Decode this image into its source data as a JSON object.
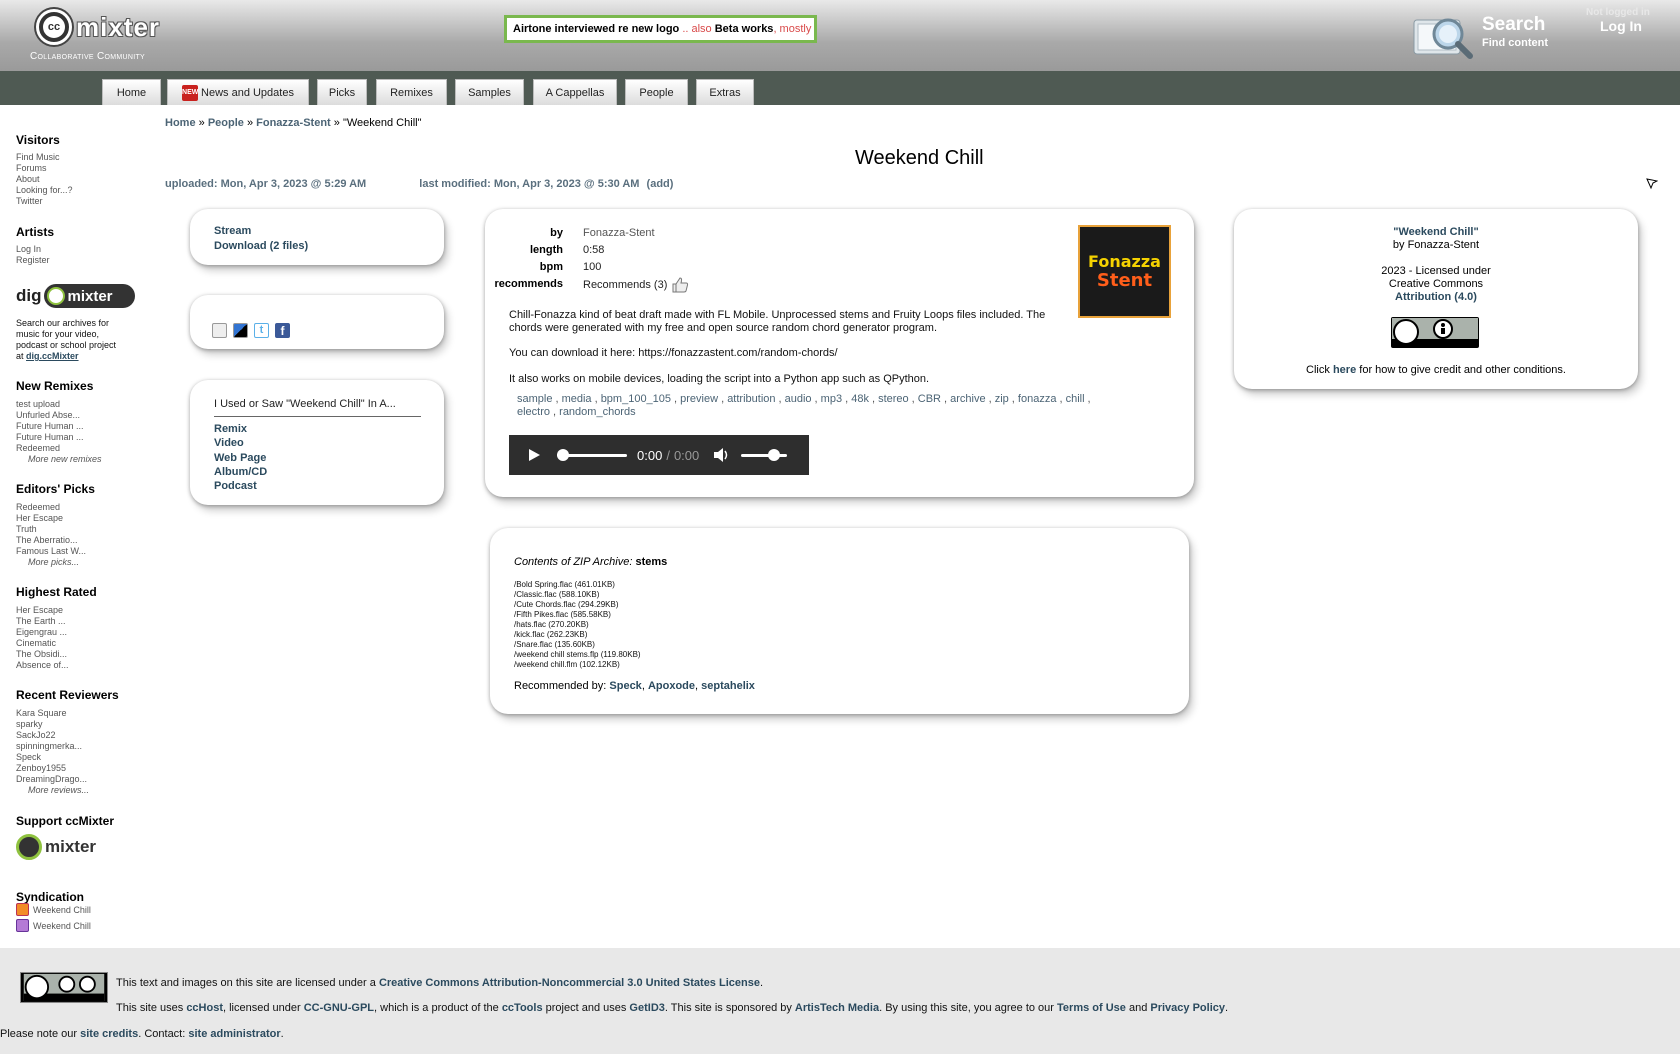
{
  "header": {
    "logo_text": "mixter",
    "tagline": "Collaborative Community",
    "banner": {
      "part1": "Airtone interviewed re new logo",
      "sep": " .. also ",
      "part2": "Beta works",
      "part3": ", mostly"
    },
    "search_title": "Search",
    "search_sub": "Find content",
    "not_logged": "Not logged in",
    "login": "Log In"
  },
  "nav": {
    "tabs": [
      {
        "label": "Home"
      },
      {
        "label": "News and Updates",
        "badge": "NEW"
      },
      {
        "label": "Picks"
      },
      {
        "label": "Remixes"
      },
      {
        "label": "Samples"
      },
      {
        "label": "A Cappellas"
      },
      {
        "label": "People"
      },
      {
        "label": "Extras"
      }
    ]
  },
  "sidebar": {
    "visitors": {
      "title": "Visitors",
      "links": [
        "Find Music",
        "Forums",
        "About",
        "Looking for...?",
        "Twitter"
      ]
    },
    "artists": {
      "title": "Artists",
      "links": [
        "Log In",
        "Register"
      ]
    },
    "dig": {
      "logo": "dig",
      "text": "Search our archives for music for your video, podcast or school project at",
      "link": "dig.ccMixter"
    },
    "new_remixes": {
      "title": "New Remixes",
      "links": [
        "test upload",
        "Unfurled Abse...",
        "Future Human ...",
        "Future Human ...",
        "Redeemed"
      ],
      "more": "More new remixes"
    },
    "editors_picks": {
      "title": "Editors' Picks",
      "links": [
        "Redeemed",
        "Her Escape",
        "Truth",
        "The Aberratio...",
        "Famous Last W..."
      ],
      "more": "More picks..."
    },
    "highest_rated": {
      "title": "Highest Rated",
      "links": [
        "Her Escape",
        "The Earth ...",
        "Eigengrau ...",
        "Cinematic",
        "The Obsidi...",
        "Absence of..."
      ]
    },
    "recent_reviewers": {
      "title": "Recent Reviewers",
      "links": [
        "Kara Square",
        "sparky",
        "SackJo22",
        "spinningmerka...",
        "Speck",
        "Zenboy1955",
        "DreamingDrago..."
      ],
      "more": "More reviews..."
    },
    "support": {
      "title": "Support ccMixter"
    },
    "syndication": {
      "title": "Syndication",
      "links": [
        "Weekend Chill",
        "Weekend Chill"
      ]
    }
  },
  "breadcrumb": {
    "home": "Home",
    "sep": "»",
    "people": "People",
    "artist": "Fonazza-Stent",
    "current": "\"Weekend Chill\""
  },
  "page": {
    "title": "Weekend Chill",
    "uploaded": "uploaded: Mon, Apr 3, 2023 @ 5:29 AM",
    "modified": "last modified: Mon, Apr 3, 2023 @ 5:30 AM",
    "add": "(add)"
  },
  "stream_panel": {
    "stream": "Stream",
    "download": "Download (2 files)"
  },
  "used_panel": {
    "heading": "I Used or Saw \"Weekend Chill\" In A...",
    "items": [
      "Remix",
      "Video",
      "Web Page",
      "Album/CD",
      "Podcast"
    ]
  },
  "details": {
    "by_label": "by",
    "by": "Fonazza-Stent",
    "length_label": "length",
    "length": "0:58",
    "bpm_label": "bpm",
    "bpm": "100",
    "recommends_label": "recommends",
    "recommends": "Recommends (3)",
    "desc1": "Chill-Fonazza kind of beat draft made with FL Mobile. Unprocessed stems and Fruity Loops files included. The chords were generated with my free and open source random chord generator program.",
    "desc2": "You can download it here: https://fonazzastent.com/random-chords/",
    "desc3": "It also works on mobile devices, loading the script into a Python app such as QPython.",
    "tags": [
      "sample",
      "media",
      "bpm_100_105",
      "preview",
      "attribution",
      "audio",
      "mp3",
      "48k",
      "stereo",
      "CBR",
      "archive",
      "zip",
      "fonazza",
      "chill",
      "electro",
      "random_chords"
    ],
    "album_line1": "Fonazza",
    "album_line2": "Stent",
    "player_time": "0:00",
    "player_sep": "/",
    "player_total": "0:00",
    "player_progress": 0.0,
    "player_volume": 0.8
  },
  "zip": {
    "label": "Contents of ZIP Archive:",
    "name": "stems",
    "files": [
      "/Bold Spring.flac (461.01KB)",
      "/Classic.flac (588.10KB)",
      "/Cute Chords.flac (294.29KB)",
      "/Fifth Pikes.flac (585.58KB)",
      "/hats.flac (270.20KB)",
      "/kick.flac (262.23KB)",
      "/Snare.flac (135.60KB)",
      "/weekend chill stems.flp (119.80KB)",
      "/weekend chill.flm (102.12KB)"
    ],
    "rec_label": "Recommended by:",
    "rec": [
      "Speck",
      "Apoxode",
      "septahelix"
    ]
  },
  "license": {
    "title": "\"Weekend Chill\"",
    "by": "by Fonazza-Stent",
    "year": "2023 - Licensed under",
    "cc": "Creative Commons",
    "attr": "Attribution (4.0)",
    "click": "Click",
    "here": "here",
    "rest": "for how to give credit and other conditions."
  },
  "footer": {
    "l1a": "This text and images on this site are licensed under a",
    "l1b": "Creative Commons Attribution-Noncommercial 3.0 United States License",
    "l2a": "This site uses",
    "ccHost": "ccHost",
    "l2b": ", licensed under",
    "gpl": "CC-GNU-GPL",
    "l2c": ", which is a product of the",
    "cctools": "ccTools",
    "l2d": "project and uses",
    "getid3": "GetID3",
    "l2e": ". This site is sponsored by",
    "artistech": "ArtisTech Media",
    "l2f": ". By using this site, you agree to our",
    "terms": "Terms of Use",
    "and": "and",
    "privacy": "Privacy Policy",
    "l3a": "Please note our",
    "credits": "site credits",
    "l3b": ". Contact:",
    "admin": "site administrator"
  },
  "colors": {
    "accent": "#2b4a5e",
    "nav_bg": "#4f5a53",
    "banner_border": "#7ab84e"
  }
}
